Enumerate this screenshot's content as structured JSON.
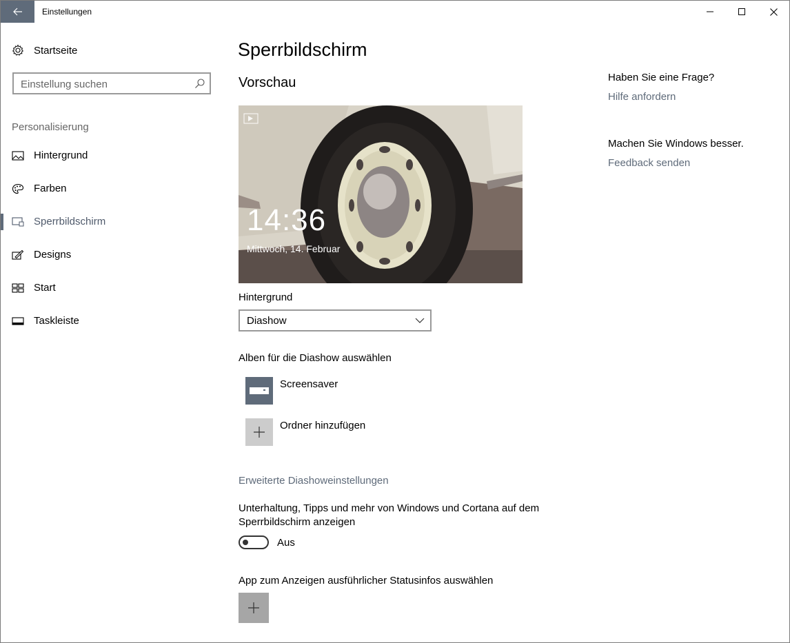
{
  "window": {
    "title": "Einstellungen"
  },
  "sidebar": {
    "home_label": "Startseite",
    "search_placeholder": "Einstellung suchen",
    "section_label": "Personalisierung",
    "items": [
      {
        "label": "Hintergrund",
        "icon": "picture-icon",
        "selected": false
      },
      {
        "label": "Farben",
        "icon": "palette-icon",
        "selected": false
      },
      {
        "label": "Sperrbildschirm",
        "icon": "lock-screen-icon",
        "selected": true
      },
      {
        "label": "Designs",
        "icon": "brush-icon",
        "selected": false
      },
      {
        "label": "Start",
        "icon": "start-tiles-icon",
        "selected": false
      },
      {
        "label": "Taskleiste",
        "icon": "taskbar-icon",
        "selected": false
      }
    ]
  },
  "main": {
    "title": "Sperrbildschirm",
    "preview_heading": "Vorschau",
    "preview": {
      "time": "14:36",
      "date": "Mittwoch, 14. Februar"
    },
    "background_label": "Hintergrund",
    "background_value": "Diashow",
    "albums_label": "Alben für die Diashow auswählen",
    "albums": [
      {
        "label": "Screensaver",
        "icon": "folder-icon"
      },
      {
        "label": "Ordner hinzufügen",
        "icon": "plus-icon"
      }
    ],
    "advanced_link": "Erweiterte Diashoweinstellungen",
    "tips_label_line1": "Unterhaltung, Tipps und mehr von Windows und Cortana auf dem",
    "tips_label_line2": "Sperrbildschirm anzeigen",
    "toggle_state": "Aus",
    "status_app_label": "App zum Anzeigen ausführlicher Statusinfos auswählen"
  },
  "help": {
    "question_heading": "Haben Sie eine Frage?",
    "help_link": "Hilfe anfordern",
    "improve_heading": "Machen Sie Windows besser.",
    "feedback_link": "Feedback senden"
  },
  "colors": {
    "accent": "#5f6b7a",
    "link": "#5f6b7a",
    "tile_gray": "#cccccc"
  }
}
